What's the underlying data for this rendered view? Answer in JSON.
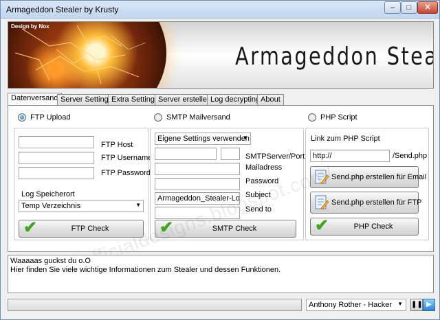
{
  "window": {
    "title": "Armageddon Stealer by Krusty",
    "min": "–",
    "max": "□",
    "close": "✕"
  },
  "banner": {
    "design_credit": "Design by Nox",
    "title": "Armageddon Stealer"
  },
  "tabs": [
    {
      "label": "Datenversand",
      "active": true
    },
    {
      "label": "Server Settings",
      "active": false
    },
    {
      "label": "Extra Settings",
      "active": false
    },
    {
      "label": "Server erstellen",
      "active": false
    },
    {
      "label": "Log decrypting",
      "active": false
    },
    {
      "label": "About",
      "active": false
    }
  ],
  "ftp": {
    "radio_label": "FTP Upload",
    "selected": true,
    "host_label": "FTP Host",
    "user_label": "FTP Username",
    "pass_label": "FTP Password",
    "host_value": "",
    "user_value": "",
    "pass_value": "",
    "log_location_label": "Log Speicherort",
    "log_location_value": "Temp Verzeichnis",
    "check_button": "FTP Check"
  },
  "smtp": {
    "radio_label": "SMTP Mailversand",
    "selected": false,
    "settings_combo": "Eigene Settings verwenden",
    "server_label": "SMTPServer/Port",
    "mail_label": "Mailadress",
    "pass_label": "Password",
    "subject_label": "Subject",
    "sendto_label": "Send to",
    "server_value": "",
    "port_value": "",
    "mail_value": "",
    "pass_value": "",
    "subject_value": "Armageddon_Stealer-Logs",
    "sendto_value": "",
    "check_button": "SMTP Check"
  },
  "php": {
    "radio_label": "PHP Script",
    "selected": false,
    "link_label": "Link zum PHP Script",
    "url_value": "http://",
    "url_suffix": "/Send.php",
    "email_button": "Send.php erstellen für Email",
    "ftp_button": "Send.php erstellen für FTP",
    "check_button": "PHP Check"
  },
  "log": {
    "line1": "Waaaaas guckst du o.O",
    "line2": "Hier finden Sie viele wichtige Informationen zum Stealer und dessen Funktionen."
  },
  "statusbar": {
    "progress": 0,
    "combo_value": "Anthony Rother - Hacker",
    "pause": "❚❚",
    "play": "▶"
  },
  "watermark": "http://officialdesigns.blogspot.com/",
  "colors": {
    "accent": "#1670c8",
    "check_green": "#4bb52a",
    "close_red": "#c64630"
  }
}
